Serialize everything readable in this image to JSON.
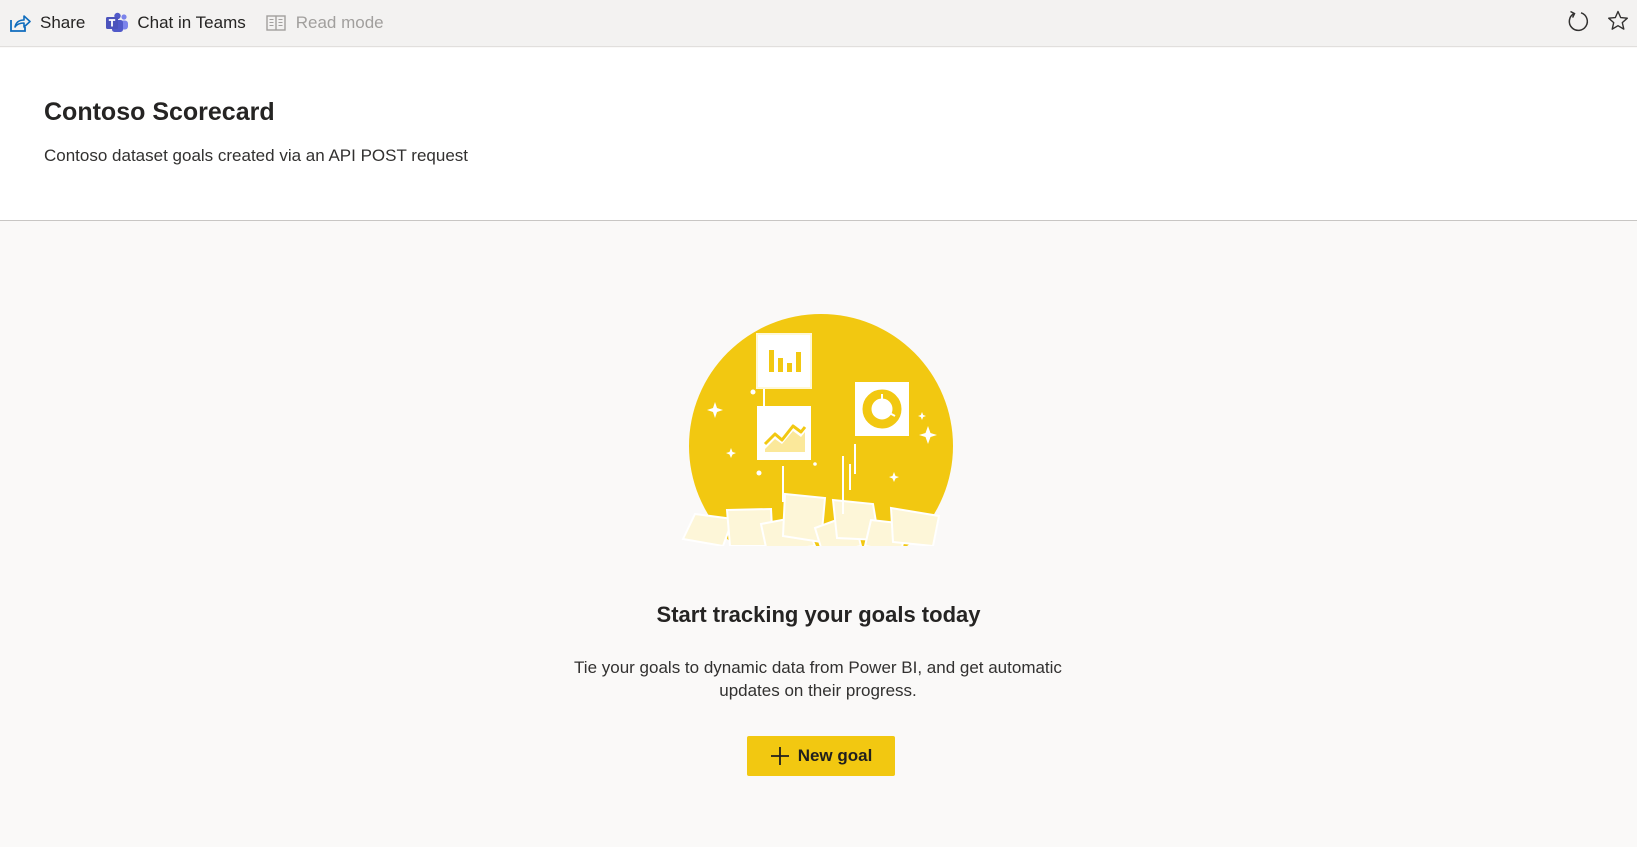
{
  "toolbar": {
    "share_label": "Share",
    "chat_label": "Chat in Teams",
    "read_mode_label": "Read mode",
    "icons": {
      "share": "share-icon",
      "teams": "teams-icon",
      "read_mode": "read-mode-icon",
      "refresh": "refresh-icon",
      "favorite": "star-icon"
    }
  },
  "header": {
    "title": "Contoso Scorecard",
    "description": "Contoso dataset goals created via an API POST request"
  },
  "empty_state": {
    "heading": "Start tracking your goals today",
    "description": "Tie your goals to dynamic data from Power BI, and get automatic updates on their progress.",
    "button_label": "New goal"
  },
  "colors": {
    "accent": "#f2c811",
    "teams": "#5059c9",
    "share": "#0f6cbd"
  }
}
